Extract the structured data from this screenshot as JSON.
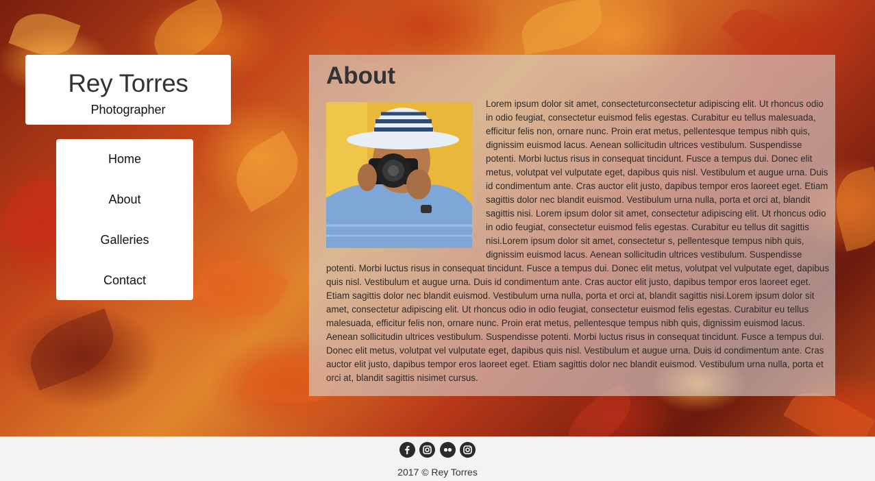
{
  "brand": {
    "name": "Rey Torres",
    "tagline": "Photographer"
  },
  "nav": {
    "items": [
      {
        "label": "Home"
      },
      {
        "label": "About"
      },
      {
        "label": "Galleries"
      },
      {
        "label": "Contact"
      }
    ]
  },
  "about": {
    "title": "About",
    "body": "Lorem ipsum dolor sit amet, consecteturconsectetur adipiscing elit. Ut rhoncus odio in odio feugiat, consectetur euismod felis egestas. Curabitur eu tellus malesuada, efficitur felis non, ornare nunc. Proin erat metus, pellentesque tempus nibh quis, dignissim euismod lacus. Aenean sollicitudin ultrices vestibulum. Suspendisse potenti. Morbi luctus risus in consequat tincidunt. Fusce a tempus dui. Donec elit metus, volutpat vel vulputate eget, dapibus quis nisl. Vestibulum et augue urna. Duis id condimentum ante. Cras auctor elit justo, dapibus tempor eros laoreet eget. Etiam sagittis dolor nec blandit euismod. Vestibulum urna nulla, porta et orci at, blandit sagittis nisi. Lorem ipsum dolor sit amet, consectetur adipiscing elit. Ut rhoncus odio in odio feugiat, consectetur euismod felis egestas. Curabitur eu tellus dit sagittis nisi.Lorem ipsum dolor sit amet, consectetur s, pellentesque tempus nibh quis, dignissim euismod lacus. Aenean sollicitudin ultrices vestibulum. Suspendisse potenti. Morbi luctus risus in consequat tincidunt. Fusce a tempus dui. Donec elit metus, volutpat vel vulputate eget, dapibus quis nisl. Vestibulum et augue urna. Duis id condimentum ante. Cras auctor elit justo, dapibus tempor eros laoreet eget. Etiam sagittis dolor nec blandit euismod. Vestibulum urna nulla, porta et orci at, blandit sagittis nisi.Lorem ipsum dolor sit amet, consectetur adipiscing elit. Ut rhoncus odio in odio feugiat, consectetur euismod felis egestas. Curabitur eu tellus malesuada, efficitur felis non, ornare nunc. Proin erat metus, pellentesque tempus nibh quis, dignissim euismod lacus. Aenean sollicitudin ultrices vestibulum. Suspendisse potenti. Morbi luctus risus in consequat tincidunt. Fusce a tempus dui. Donec elit metus, volutpat vel vulputate eget, dapibus quis nisl. Vestibulum et augue urna. Duis id condimentum ante. Cras auctor elit justo, dapibus tempor eros laoreet eget. Etiam sagittis dolor nec blandit euismod. Vestibulum urna nulla, porta et orci at, blandit sagittis nisimet cursus."
  },
  "footer": {
    "socials": [
      {
        "icon": "facebook-icon"
      },
      {
        "icon": "instagram-icon"
      },
      {
        "icon": "flickr-icon"
      },
      {
        "icon": "instagram-icon"
      }
    ],
    "copyright": "2017 © Rey Torres"
  }
}
